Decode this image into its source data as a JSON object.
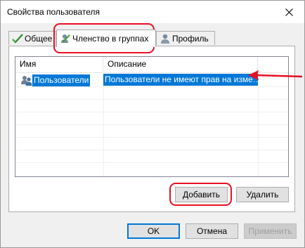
{
  "window": {
    "title": "Свойства пользователя"
  },
  "tabs": [
    {
      "label": "Общее",
      "icon": "check-icon"
    },
    {
      "label": "Членство в группах",
      "icon": "group-icon",
      "active": true
    },
    {
      "label": "Профиль",
      "icon": "user-profile-icon"
    }
  ],
  "list": {
    "columns": [
      "Имя",
      "Описание"
    ],
    "rows": [
      {
        "name": "Пользователи",
        "description": "Пользователи не имеют прав на изме…",
        "selected": true
      }
    ]
  },
  "buttons": {
    "add": "Добавить",
    "remove": "Удалить",
    "ok": "OK",
    "cancel": "Отмена",
    "apply": "Применить"
  },
  "colors": {
    "selection": "#0078d7",
    "annotation": "#e81123"
  }
}
